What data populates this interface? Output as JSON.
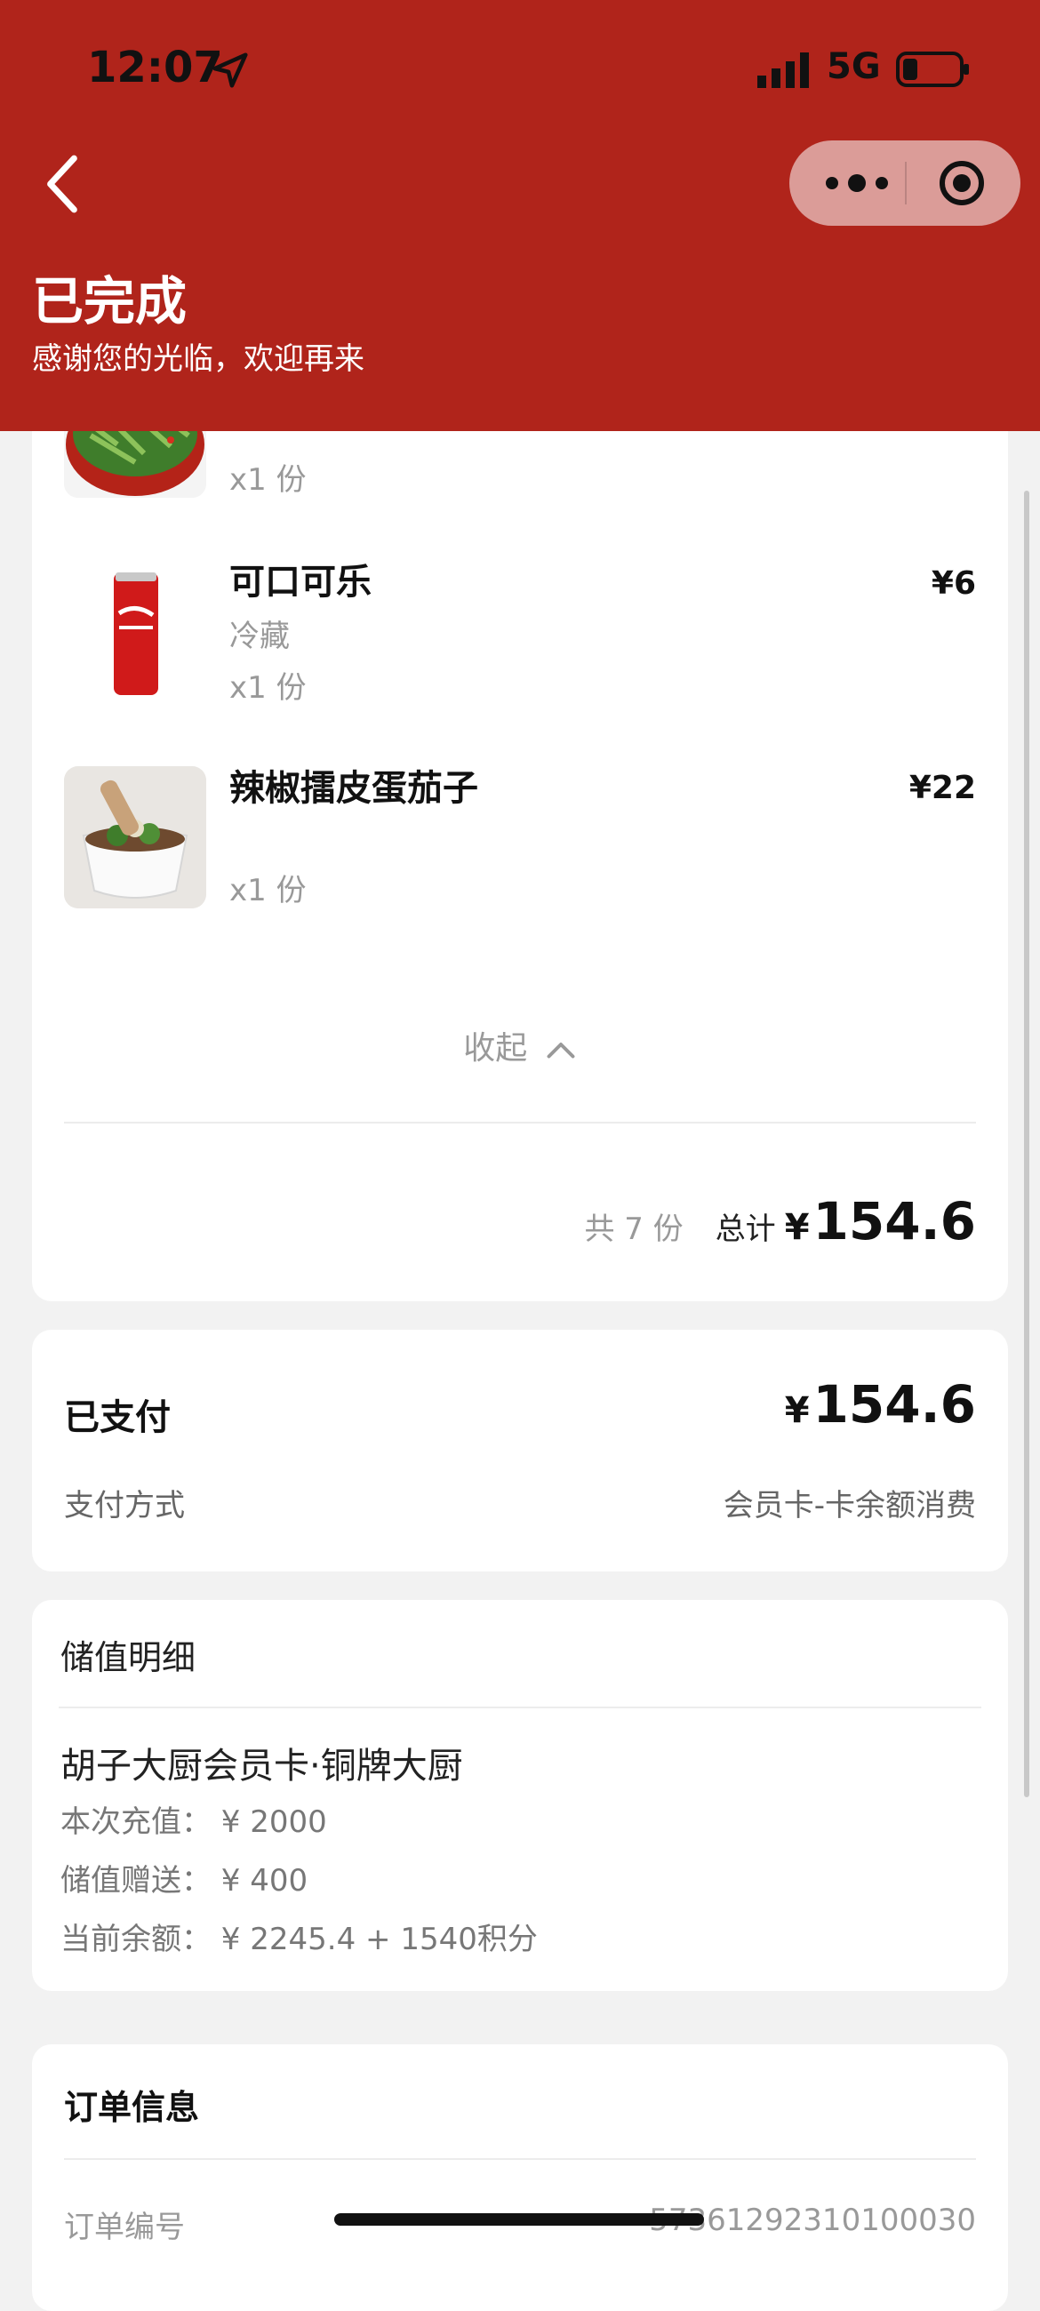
{
  "status_bar": {
    "time": "12:07",
    "network": "5G"
  },
  "header": {
    "title": "已完成",
    "subtitle": "感谢您的光临，欢迎再来"
  },
  "items": [
    {
      "name": "",
      "spec": "",
      "qty": "x1 份",
      "price": ""
    },
    {
      "name": "可口可乐",
      "spec": "冷藏",
      "qty": "x1 份",
      "price": "¥6"
    },
    {
      "name": "辣椒擂皮蛋茄子",
      "spec": "",
      "qty": "x1 份",
      "price": "¥22"
    }
  ],
  "collapse_label": "收起",
  "summary": {
    "count": "共 7 份",
    "total_label": "总计",
    "currency": "¥",
    "total": "154.6"
  },
  "payment": {
    "status": "已支付",
    "currency": "¥",
    "amount": "154.6",
    "method_label": "支付方式",
    "method_value": "会员卡-卡余额消费"
  },
  "stored_value": {
    "title": "储值明细",
    "card_name": "胡子大厨会员卡·铜牌大厨",
    "recharge": "本次充值： ¥ 2000",
    "gift": "储值赠送： ¥ 400",
    "balance": "当前余额： ¥ 2245.4 + 1540积分"
  },
  "order_info": {
    "title": "订单信息",
    "number_label": "订单编号",
    "number_value": "57361292310100030"
  },
  "colors": {
    "header_bg": "#b0241b",
    "page_bg": "#f2f2f2"
  }
}
